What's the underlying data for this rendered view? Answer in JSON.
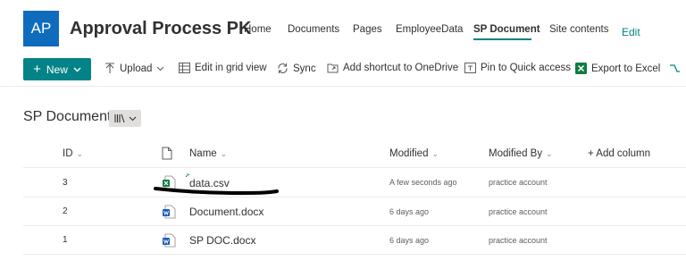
{
  "site": {
    "logo_initials": "AP",
    "title": "Approval Process PK",
    "nav": [
      "Home",
      "Documents",
      "Pages",
      "EmployeeData",
      "SP Document",
      "Site contents"
    ],
    "nav_active": "SP Document",
    "edit_label": "Edit"
  },
  "commands": {
    "new_label": "New",
    "upload": "Upload",
    "edit_grid": "Edit in grid view",
    "sync": "Sync",
    "add_shortcut": "Add shortcut to OneDrive",
    "pin": "Pin to Quick access",
    "export": "Export to Excel"
  },
  "library": {
    "title": "SP Document"
  },
  "table": {
    "headers": {
      "id": "ID",
      "name": "Name",
      "modified": "Modified",
      "modified_by": "Modified By",
      "add_column": "+ Add column"
    },
    "rows": [
      {
        "id": "3",
        "name": "data.csv",
        "modified": "A few seconds ago",
        "modified_by": "practice account",
        "icon": "excel-csv-icon"
      },
      {
        "id": "2",
        "name": "Document.docx",
        "modified": "6 days ago",
        "modified_by": "practice account",
        "icon": "word-icon"
      },
      {
        "id": "1",
        "name": "SP DOC.docx",
        "modified": "6 days ago",
        "modified_by": "practice account",
        "icon": "word-icon"
      }
    ]
  },
  "colors": {
    "accent": "#038387",
    "logo": "#0f6cbd",
    "excel": "#107c41",
    "word": "#185abd"
  }
}
